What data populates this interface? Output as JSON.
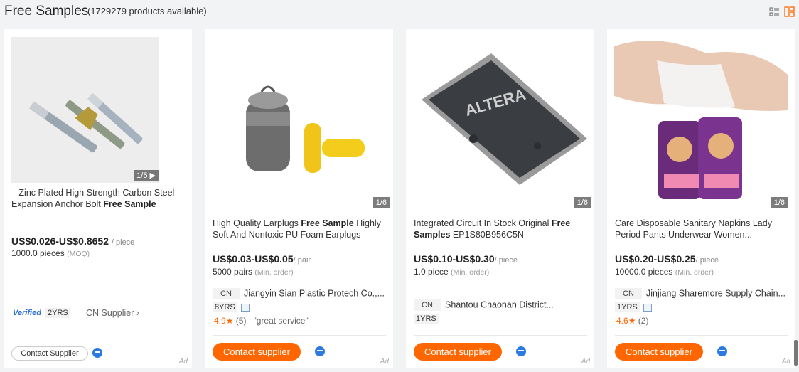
{
  "header": {
    "title": "Free Samples",
    "count": "(1729279 products available)"
  },
  "colors": {
    "accent": "#ff6600",
    "link": "#2a7ae2",
    "bg": "#f2f3f5"
  },
  "products": [
    {
      "title_pre": "Zinc Plated High Strength Carbon Steel Expansion Anchor Bolt ",
      "title_bold": "Free Sample",
      "title_post": "",
      "image_counter": "1/5",
      "price": "US$0.026-US$0.8652",
      "price_unit": "/ piece",
      "moq": "1000.0 pieces",
      "moq_note": "(MOQ)",
      "verified": "Verified",
      "years": "2YRS",
      "supplier_link": "CN Supplier",
      "button": "Contact Supplier",
      "ad": "Ad"
    },
    {
      "title_pre": "High Quality Earplugs ",
      "title_bold": "Free Sample",
      "title_post": " Highly Soft And Nontoxic PU Foam Earplugs",
      "image_counter": "1/6",
      "price": "US$0.03-US$0.05",
      "price_unit": "/ pair",
      "moq": "5000 pairs",
      "moq_note": "(Min. order)",
      "country": "CN",
      "supplier": "Jiangyin Sian Plastic Protech Co.,...",
      "years": "8YRS",
      "score": "4.9",
      "reviews": "(5)",
      "review_quote": "\"great service\"",
      "button": "Contact supplier",
      "ad": "Ad"
    },
    {
      "title_pre": "Integrated Circuit In Stock Original ",
      "title_bold": "Free Samples",
      "title_post": " EP1S80B956C5N",
      "image_counter": "1/6",
      "price": "US$0.10-US$0.30",
      "price_unit": "/ piece",
      "moq": "1.0 piece",
      "moq_note": "(Min. order)",
      "country": "CN",
      "supplier": "Shantou Chaonan District...",
      "years": "1YRS",
      "button": "Contact supplier",
      "ad": "Ad"
    },
    {
      "title_pre": "Care Disposable Sanitary Napkins Lady Period Pants Underwear Women...",
      "title_bold": "",
      "title_post": "",
      "image_counter": "1/6",
      "price": "US$0.20-US$0.25",
      "price_unit": "/ piece",
      "moq": "10000.0 pieces",
      "moq_note": "(Min. order)",
      "country": "CN",
      "supplier": "Jinjiang Sharemore Supply Chain...",
      "years": "1YRS",
      "score": "4.6",
      "reviews": "(2)",
      "button": "Contact supplier",
      "ad": "Ad"
    }
  ]
}
